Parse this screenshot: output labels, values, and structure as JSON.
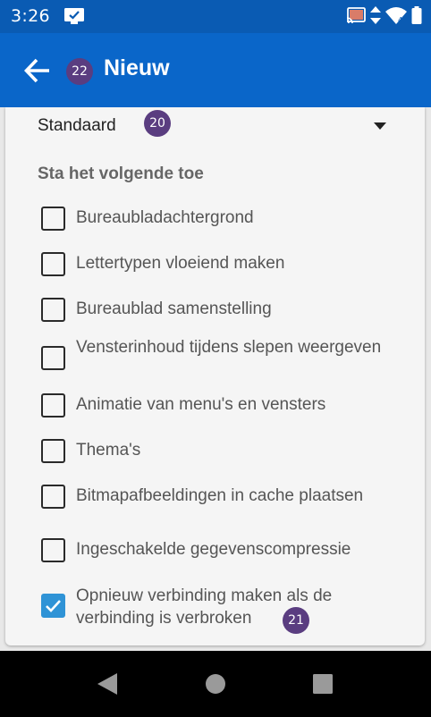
{
  "status_bar": {
    "time": "3:26",
    "left_icon": "screen-share-icon",
    "right_icons": [
      "cast-icon",
      "data-arrows-icon",
      "wifi-icon",
      "battery-icon"
    ]
  },
  "app_bar": {
    "title": "Nieuw",
    "back_icon": "arrow-back-icon",
    "badge": "22"
  },
  "dropdown": {
    "value": "Standaard",
    "badge": "20"
  },
  "section": {
    "heading": "Sta het volgende toe"
  },
  "options": [
    {
      "label": "Bureaubladachtergrond",
      "checked": false
    },
    {
      "label": "Lettertypen vloeiend maken",
      "checked": false
    },
    {
      "label": "Bureaublad samenstelling",
      "checked": false
    },
    {
      "label": "Vensterinhoud tijdens slepen weergeven",
      "checked": false
    },
    {
      "label": "Animatie van menu's en vensters",
      "checked": false
    },
    {
      "label": "Thema's",
      "checked": false
    },
    {
      "label": "Bitmapafbeeldingen in cache plaatsen",
      "checked": false
    },
    {
      "label": "Ingeschakelde gegevenscompressie",
      "checked": false
    },
    {
      "label": "Opnieuw verbinding maken als de verbinding is verbroken",
      "checked": true,
      "badge": "21"
    }
  ],
  "nav_bar": {
    "buttons": [
      "back-triangle-icon",
      "home-circle-icon",
      "recents-square-icon"
    ]
  },
  "colors": {
    "status_bar": "#0a5bb3",
    "app_bar": "#0a66c9",
    "badge": "#5a3d80",
    "checkbox_checked": "#2f93d6"
  }
}
